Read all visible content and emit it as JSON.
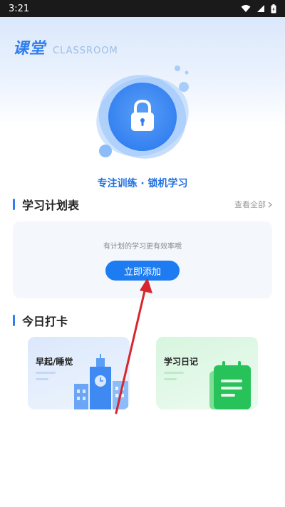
{
  "status_bar": {
    "time": "3:21"
  },
  "brand": {
    "title": "课堂",
    "subtitle": "CLASSROOM"
  },
  "hero": {
    "icon": "lock-icon",
    "tagline": "专注训练 · 锁机学习"
  },
  "plan": {
    "title": "学习计划表",
    "view_all": "查看全部",
    "empty_hint": "有计划的学习更有效率哦",
    "add_button": "立即添加"
  },
  "checkin": {
    "title": "今日打卡",
    "cards": [
      {
        "label": "早起/睡觉",
        "icon": "school-building-icon"
      },
      {
        "label": "学习日记",
        "icon": "notebook-icon"
      }
    ]
  },
  "colors": {
    "accent": "#2f7df0",
    "button": "#1d7cf2",
    "annotation_arrow": "#d7262e"
  }
}
